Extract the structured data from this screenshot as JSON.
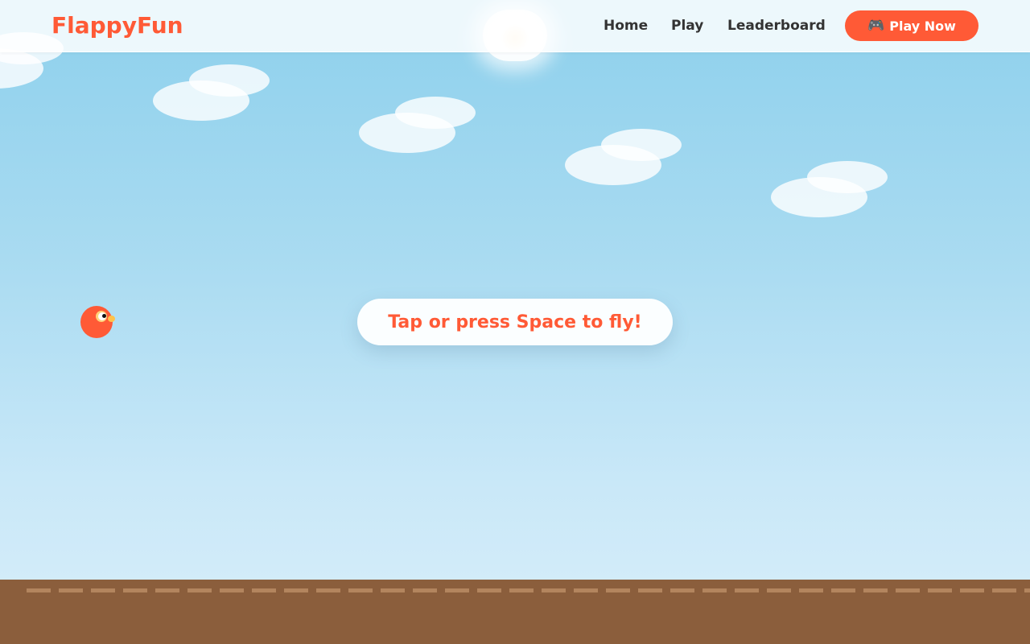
{
  "app": {
    "logo": "FlappyFun"
  },
  "nav": {
    "home": "Home",
    "play": "Play",
    "leaderboard": "Leaderboard",
    "cta_icon": "🎮",
    "cta_label": "Play Now"
  },
  "game": {
    "prompt": "Tap or press Space to fly!"
  },
  "colors": {
    "accent": "#ff5a36",
    "sky_top": "#8dd0ec",
    "sky_bottom": "#d8eefa",
    "ground": "#8b5e3c",
    "ground_stripe": "#b3855e"
  },
  "icons": {
    "cta": "gamepad-icon"
  }
}
